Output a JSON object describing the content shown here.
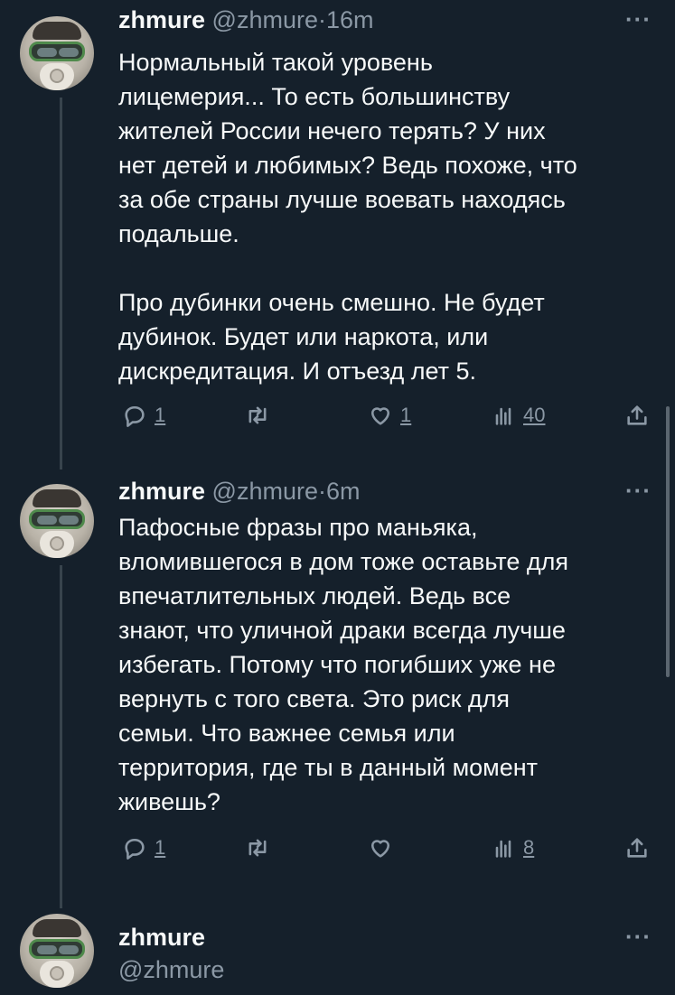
{
  "tweets": [
    {
      "name": "zhmure",
      "handle": "@zhmure",
      "dot": "·",
      "time": "16m",
      "more": "···",
      "text": "Нормальный такой уровень\nлицемерия... То есть большинству\nжителей России нечего терять? У них\nнет детей и любимых? Ведь похоже, что\nза обе страны лучше воевать находясь\nподальше.\n\nПро дубинки очень смешно. Не будет\nдубинок. Будет или наркота, или\nдискредитация. И отъезд лет 5.",
      "replies": "1",
      "retweets": "",
      "likes": "1",
      "views": "40"
    },
    {
      "name": "zhmure",
      "handle": "@zhmure",
      "dot": "·",
      "time": "6m",
      "more": "···",
      "text": "Пафосные фразы про маньяка,\nвломившегося в дом тоже оставьте для\nвпечатлительных людей. Ведь все\nзнают, что уличной драки всегда лучше\nизбегать. Потому что погибших уже не\nвернуть с того света. Это риск для\nсемьи. Что важнее семья или\nтерритория, где ты в данный момент\nживешь?",
      "replies": "1",
      "retweets": "",
      "likes": "",
      "views": "8"
    }
  ],
  "composer": {
    "name": "zhmure",
    "handle": "@zhmure",
    "more": "···"
  },
  "icons": [
    "reply-icon",
    "retweet-icon",
    "like-icon",
    "views-icon",
    "share-icon"
  ],
  "colors": {
    "background": "#15202b",
    "text": "#f7f9f9",
    "muted": "#8b98a5",
    "thread_line": "#38444d"
  }
}
